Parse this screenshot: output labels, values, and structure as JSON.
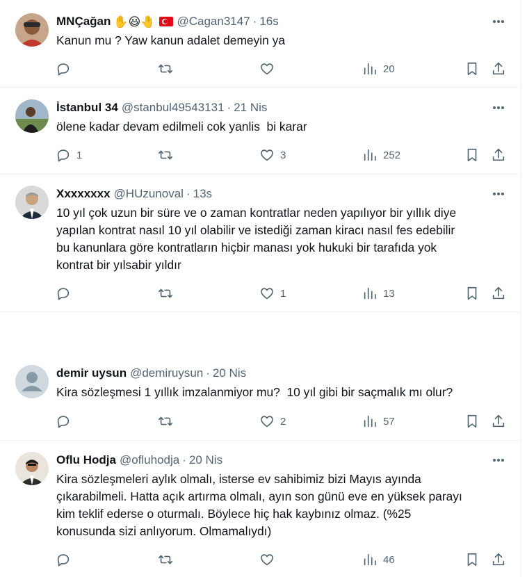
{
  "tweets": [
    {
      "name": "MNÇağan",
      "emojis": "✋😃🤚",
      "has_flag": true,
      "handle": "@Cagan3147",
      "separator": "·",
      "time": "16s",
      "text": "Kanun mu ? Yaw kanun adalet demeyin ya",
      "replies": "",
      "likes": "",
      "views": "20"
    },
    {
      "name": "İstanbul 34",
      "emojis": "",
      "has_flag": false,
      "handle": "@stanbul49543131",
      "separator": "·",
      "time": "21 Nis",
      "text": "ölene kadar devam edilmeli cok yanlis  bi karar",
      "replies": "1",
      "likes": "3",
      "views": "252"
    },
    {
      "name": "Xxxxxxxx",
      "emojis": "",
      "has_flag": false,
      "handle": "@HUzunoval",
      "separator": "·",
      "time": "13s",
      "text": "10 yıl çok uzun bir süre ve o zaman kontratlar neden yapılıyor bir yıllık diye\nyapılan kontrat nasıl 10 yıl olabilir ve istediği zaman kiracı nasıl fes edebilir\nbu kanunlara göre kontratların hiçbir manası yok hukuki bir tarafıda yok\nkontrat bir yılsabir yıldır",
      "replies": "",
      "likes": "1",
      "views": "13"
    },
    {
      "name": "demir uysun",
      "emojis": "",
      "has_flag": false,
      "handle": "@demiruysun",
      "separator": "·",
      "time": "20 Nis",
      "text": "Kira sözleşmesi 1 yıllık imzalanmiyor mu?  10 yıl gibi bir saçmalık mı olur?",
      "replies": "",
      "likes": "2",
      "views": "57"
    },
    {
      "name": "Oflu Hodja",
      "emojis": "",
      "has_flag": false,
      "handle": "@ofluhodja",
      "separator": "·",
      "time": "20 Nis",
      "text": "Kira sözleşmeleri aylık olmalı, isterse ev sahibimiz bizi Mayıs ayında\nçıkarabilmeli. Hatta açık artırma olmalı, ayın son günü eve en yüksek parayı\nkim teklif ederse o oturmalı. Böylece hiç hak kaybınız olmaz. (%25\nkonusunda sizi anlıyorum. Olmamalıydı)",
      "replies": "",
      "likes": "",
      "views": "46"
    }
  ],
  "icons": {
    "reply": "reply-icon",
    "retweet": "retweet-icon",
    "like": "heart-icon",
    "views": "views-icon",
    "bookmark": "bookmark-icon",
    "share": "share-icon",
    "more": "more-icon"
  },
  "colors": {
    "text": "#0f1419",
    "secondary": "#536471",
    "border": "#eff3f4",
    "flag_red": "#e30a17"
  }
}
